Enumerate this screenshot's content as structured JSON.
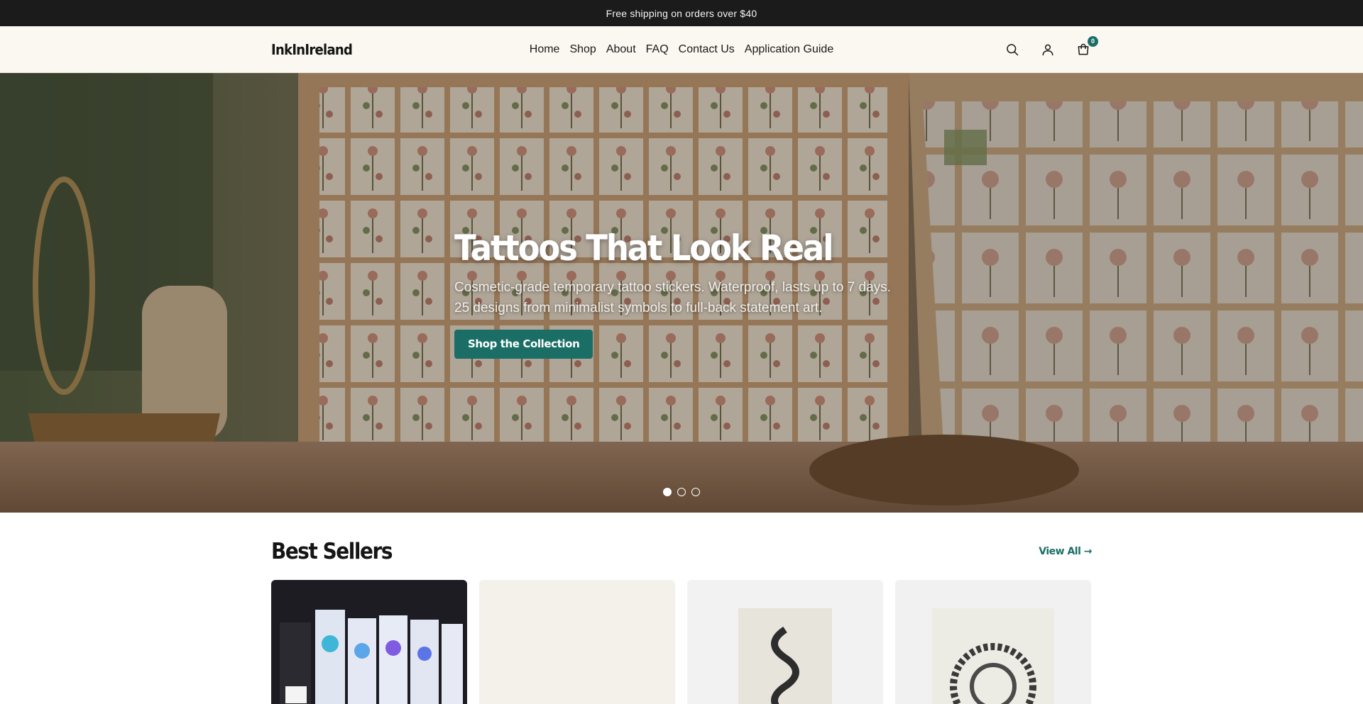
{
  "announcement": {
    "text": "Free shipping on orders over $40"
  },
  "header": {
    "logo": "InkInIreland",
    "nav": [
      {
        "label": "Home"
      },
      {
        "label": "Shop"
      },
      {
        "label": "About"
      },
      {
        "label": "FAQ"
      },
      {
        "label": "Contact Us"
      },
      {
        "label": "Application Guide"
      }
    ],
    "icons": [
      "search-icon",
      "account-icon",
      "cart-icon"
    ],
    "cart_count": "0"
  },
  "hero": {
    "title": "Tattoos That Look Real",
    "subtitle_line1": "Cosmetic-grade temporary tattoo stickers. Waterproof, lasts up to 7 days.",
    "subtitle_line2": "25 designs from minimalist symbols to full-back statement art.",
    "cta_label": "Shop the Collection",
    "slides": 3,
    "active_slide": 1
  },
  "best_sellers": {
    "title": "Best Sellers",
    "view_all_label": "View All →"
  },
  "colors": {
    "accent": "#1a6e66",
    "announcement_bg": "#1b1b1b",
    "header_bg": "#fbf8f2"
  }
}
